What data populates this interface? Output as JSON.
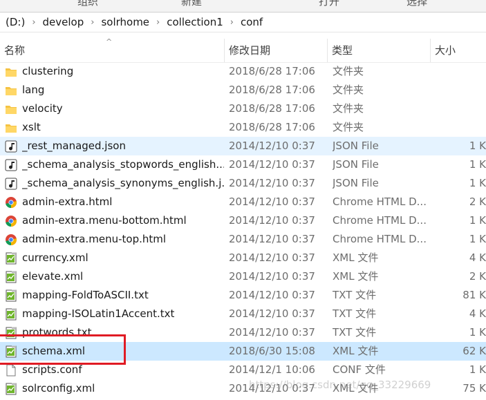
{
  "ribbon": {
    "items": [
      "组织",
      "新建",
      "打开",
      "选择"
    ]
  },
  "breadcrumb": [
    "(D:)",
    "develop",
    "solrhome",
    "collection1",
    "conf"
  ],
  "columns": {
    "name": "名称",
    "date": "修改日期",
    "type": "类型",
    "size": "大小"
  },
  "files": [
    {
      "name": "clustering",
      "date": "2018/6/28 17:06",
      "type": "文件夹",
      "size": "",
      "icon": "folder-icon"
    },
    {
      "name": "lang",
      "date": "2018/6/28 17:06",
      "type": "文件夹",
      "size": "",
      "icon": "folder-icon"
    },
    {
      "name": "velocity",
      "date": "2018/6/28 17:06",
      "type": "文件夹",
      "size": "",
      "icon": "folder-icon"
    },
    {
      "name": "xslt",
      "date": "2018/6/28 17:06",
      "type": "文件夹",
      "size": "",
      "icon": "folder-icon"
    },
    {
      "name": "_rest_managed.json",
      "date": "2014/12/10 0:37",
      "type": "JSON File",
      "size": "1 K",
      "icon": "json-file-icon"
    },
    {
      "name": "_schema_analysis_stopwords_english...",
      "date": "2014/12/10 0:37",
      "type": "JSON File",
      "size": "1 K",
      "icon": "json-file-icon"
    },
    {
      "name": "_schema_analysis_synonyms_english.j...",
      "date": "2014/12/10 0:37",
      "type": "JSON File",
      "size": "1 K",
      "icon": "json-file-icon"
    },
    {
      "name": "admin-extra.html",
      "date": "2014/12/10 0:37",
      "type": "Chrome HTML D...",
      "size": "2 K",
      "icon": "chrome-icon"
    },
    {
      "name": "admin-extra.menu-bottom.html",
      "date": "2014/12/10 0:37",
      "type": "Chrome HTML D...",
      "size": "1 K",
      "icon": "chrome-icon"
    },
    {
      "name": "admin-extra.menu-top.html",
      "date": "2014/12/10 0:37",
      "type": "Chrome HTML D...",
      "size": "1 K",
      "icon": "chrome-icon"
    },
    {
      "name": "currency.xml",
      "date": "2014/12/10 0:37",
      "type": "XML 文件",
      "size": "4 K",
      "icon": "xml-file-icon"
    },
    {
      "name": "elevate.xml",
      "date": "2014/12/10 0:37",
      "type": "XML 文件",
      "size": "2 K",
      "icon": "xml-file-icon"
    },
    {
      "name": "mapping-FoldToASCII.txt",
      "date": "2014/12/10 0:37",
      "type": "TXT 文件",
      "size": "81 K",
      "icon": "txt-file-icon"
    },
    {
      "name": "mapping-ISOLatin1Accent.txt",
      "date": "2014/12/10 0:37",
      "type": "TXT 文件",
      "size": "4 K",
      "icon": "txt-file-icon"
    },
    {
      "name": "protwords.txt",
      "date": "2014/12/10 0:37",
      "type": "TXT 文件",
      "size": "1 K",
      "icon": "txt-file-icon"
    },
    {
      "name": "schema.xml",
      "date": "2018/6/30 15:08",
      "type": "XML 文件",
      "size": "62 K",
      "icon": "xml-file-icon"
    },
    {
      "name": "scripts.conf",
      "date": "2014/12/1 10:06",
      "type": "CONF 文件",
      "size": "1 K",
      "icon": "blank-file-icon"
    },
    {
      "name": "solrconfig.xml",
      "date": "2014/12/10 0:37",
      "type": "XML 文件",
      "size": "75 K",
      "icon": "xml-file-icon"
    }
  ],
  "state": {
    "hover_row": 4,
    "selected_row": 15
  },
  "colors": {
    "hover": "#e5f3ff",
    "selected": "#cce8ff",
    "highlight": "#e01b24",
    "folder": "#f5c343"
  },
  "watermark": "https://blog.csdn.net/qq_33229669"
}
